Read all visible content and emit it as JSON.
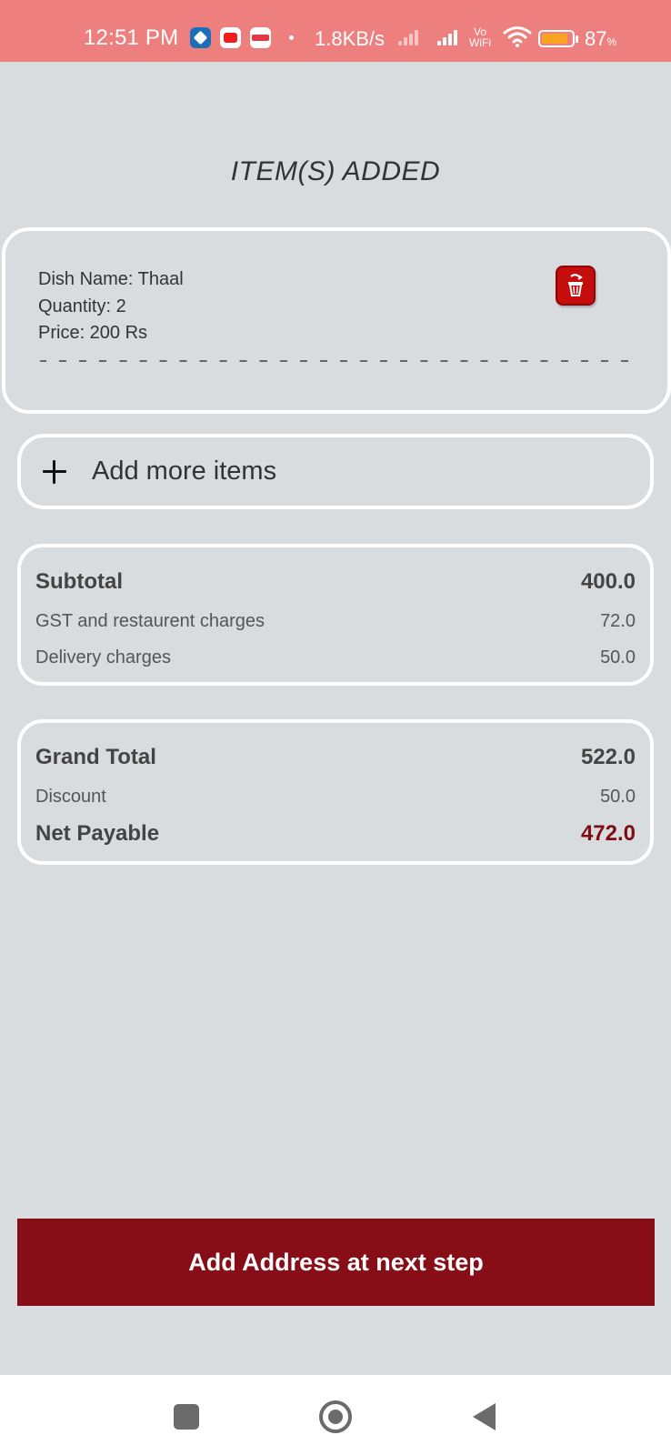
{
  "status_bar": {
    "time": "12:51 PM",
    "apps": [
      "dominos-icon",
      "youtube-icon",
      "zomato-icon"
    ],
    "net_speed": "1.8KB/s",
    "vowifi_top": "Vo",
    "vowifi_bottom": "WiFi",
    "battery_percent": "87",
    "battery_unit": "%",
    "battery_level": 0.87
  },
  "page": {
    "title": "ITEM(S) ADDED"
  },
  "item": {
    "dish_name": "Dish Name: Thaal",
    "quantity": "Quantity: 2",
    "price": "Price: 200 Rs"
  },
  "add_more": {
    "label": "Add more items"
  },
  "summary": {
    "subtotal_label": "Subtotal",
    "subtotal_value": "400.0",
    "gst_label": "GST and restaurent charges",
    "gst_value": "72.0",
    "delivery_label": "Delivery charges",
    "delivery_value": "50.0"
  },
  "totals": {
    "grand_total_label": "Grand Total",
    "grand_total_value": "522.0",
    "discount_label": "Discount",
    "discount_value": "50.0",
    "net_payable_label": "Net Payable",
    "net_payable_value": "472.0"
  },
  "next_button": {
    "label": "Add Address at next step"
  },
  "colors": {
    "status_bar": "#ee7f7f",
    "background": "#d9dcde",
    "primary": "#870d17",
    "net_payable": "#7d0c15",
    "delete_icon": "#c50d0d"
  }
}
